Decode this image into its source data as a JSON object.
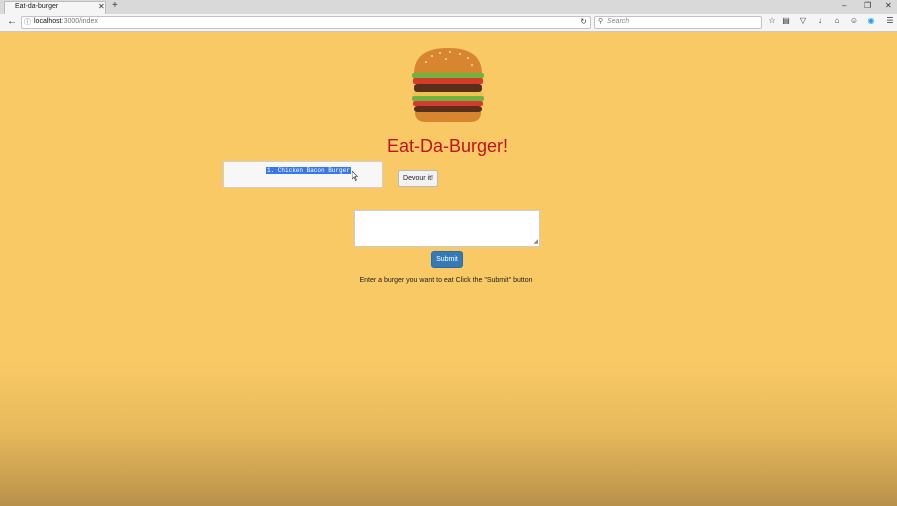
{
  "browser": {
    "tab_title": "Eat-da-burger",
    "url_host": "localhost",
    "url_path": ":3000/index",
    "search_placeholder": "Search",
    "new_tab_glyph": "+",
    "close_glyph": "✕",
    "icons": [
      "back-arrow-icon",
      "site-info-icon",
      "reload-icon",
      "search-icon",
      "star-icon",
      "clipboard-icon",
      "pocket-icon",
      "download-icon",
      "home-icon",
      "smiley-icon",
      "skype-icon",
      "menu-icon"
    ]
  },
  "page": {
    "title": "Eat-Da-Burger!",
    "burgers": [
      {
        "label": "1. Chicken Bacon Burger"
      }
    ],
    "devour_label": "Devour it!",
    "input_value": "",
    "submit_label": "Submit",
    "instructions": "Enter a burger you want to eat Click the \"Submit\" button",
    "colors": {
      "background": "#f8c965",
      "title": "#c1121f",
      "submit": "#337ab7",
      "selection": "#3b78e7"
    }
  }
}
